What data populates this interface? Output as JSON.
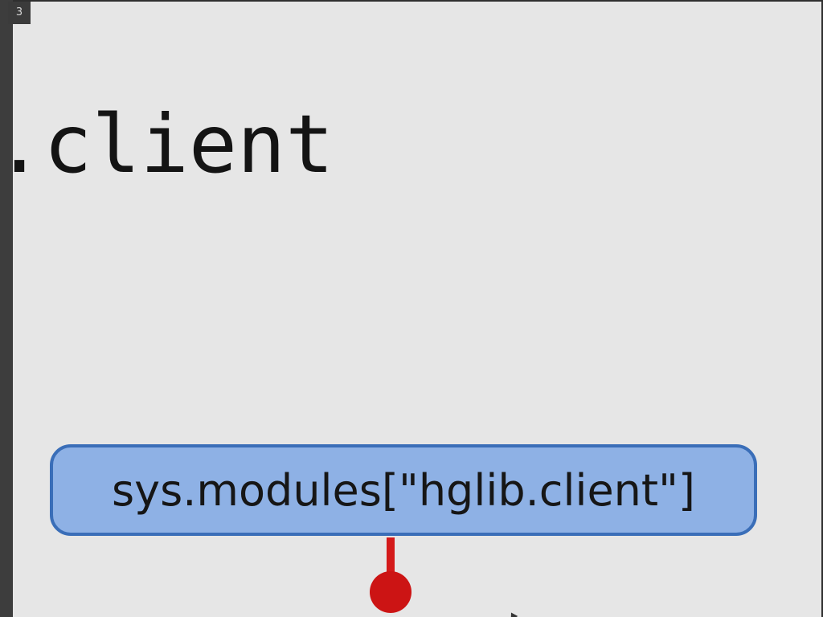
{
  "viewer": {
    "page_number": "3"
  },
  "slide": {
    "heading_code": ".client",
    "callout_text": "sys.modules[\"hglib.client\"]"
  },
  "colors": {
    "slide_background": "#e6e6e6",
    "callout_fill": "#8eb1e5",
    "callout_border": "#3a6eb8",
    "pointer_marker": "#cc1414"
  },
  "icons": {
    "pointer_marker": "pin-marker-icon",
    "cursor": "mouse-cursor-icon"
  }
}
